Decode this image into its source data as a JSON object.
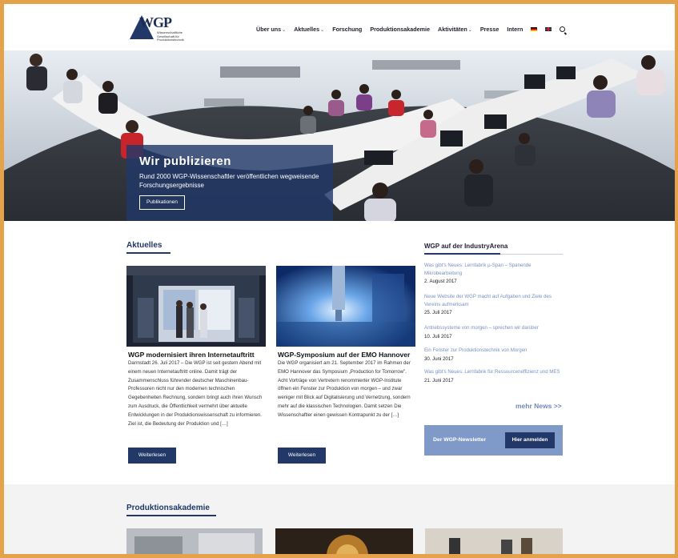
{
  "header": {
    "logo_text": "WGP",
    "logo_sub": "Wissenschaftliche Gesellschaft für Produktionstechnik",
    "nav": [
      {
        "label": "Über uns",
        "dropdown": true
      },
      {
        "label": "Aktuelles",
        "dropdown": true
      },
      {
        "label": "Forschung",
        "dropdown": false
      },
      {
        "label": "Produktionsakademie",
        "dropdown": false
      },
      {
        "label": "Aktivitäten",
        "dropdown": true
      },
      {
        "label": "Presse",
        "dropdown": false
      },
      {
        "label": "Intern",
        "dropdown": false
      }
    ],
    "icons": [
      "flag-de-icon",
      "flag-en-icon",
      "search-icon"
    ]
  },
  "hero": {
    "title": "Wir publizieren",
    "subtitle": "Rund 2000 WGP-Wissenschaftler veröffentlichen wegweisende Forschungsergebnisse",
    "button": "Publikationen"
  },
  "news": {
    "title": "Aktuelles",
    "cards": [
      {
        "title": "WGP modernisiert ihren Internetauftritt",
        "text": "Darmstadt 26. Juli 2017 –  Die WGP ist seit gestern Abend mit einem neuen Internetauftritt online. Damit trägt der Zusammenschluss führender deutscher Maschinenbau-Professoren nicht nur den modernen technischen Gegebenheiten Rechnung, sondern bringt auch ihren Wunsch zum Ausdruck, die Öffentlichkeit vermehrt über aktuelle Entwicklungen in der Produktionswissenschaft zu informieren. Ziel ist, die Bedeutung der Produktion und […]",
        "button": "Weiterlesen"
      },
      {
        "title": "WGP-Symposium auf der EMO Hannover",
        "text": "Die WGP organisiert am 21. September 2017 im Rahmen der EMO Hannover das Symposium „Production for Tomorrow\". Acht Vorträge von Vertretern renommierter WGP-Institute öffnen ein Fenster zur Produktion von morgen – und zwar weniger mit Blick auf Digitalisierung und Vernetzung, sondern mehr auf die klassischen Technologien. Damit setzen Die Wissenschaftler einen gewissen Kontrapunkt zu der […]",
        "button": "Weiterlesen"
      }
    ]
  },
  "sidebar": {
    "title": "WGP auf der IndustryArena",
    "items": [
      {
        "link": "Was gibt's Neues: Lernfabrik µ-Span – Spanende Mikrobearbeitung",
        "date": "2. August 2017"
      },
      {
        "link": "Neue Website der WGP macht auf Aufgaben und Ziele des Vereins aufmerksam",
        "date": "25. Juli 2017"
      },
      {
        "link": "Antriebssysteme von morgen – sprechen wir darüber",
        "date": "10. Juli 2017"
      },
      {
        "link": "Ein Fenster zur Produktionstechnik von Morgen",
        "date": "30. Juni 2017"
      },
      {
        "link": "Was gibt's Neues: Lernfabrik für Ressourceneffizienz und MES",
        "date": "21. Juni 2017"
      }
    ],
    "more": "mehr News >>",
    "newsletter_label": "Der WGP-Newsletter",
    "newsletter_button": "Hier anmelden"
  },
  "academy": {
    "title": "Produktionsakademie"
  },
  "colors": {
    "brand": "#213868",
    "link": "#7a8fc0",
    "newsletter_bg": "#7f9ac9",
    "frame": "#e4a24b"
  }
}
